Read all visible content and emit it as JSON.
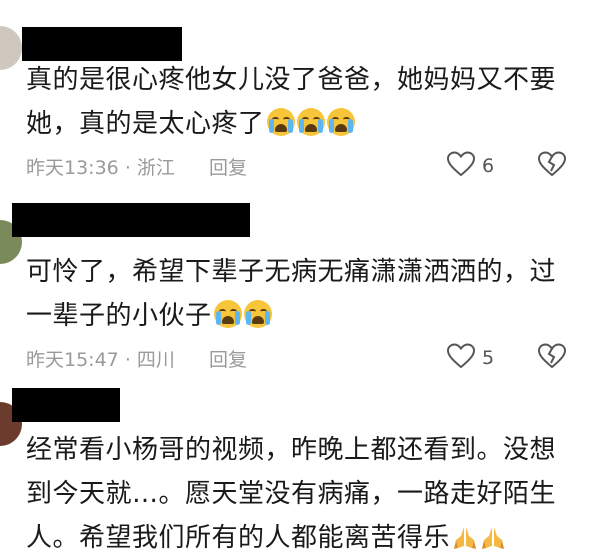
{
  "comments": [
    {
      "lines": [
        "真的是很心疼他女儿没了爸爸，她妈妈又不要",
        "她，真的是太心疼了"
      ],
      "emoji": [
        "crying-face-icon",
        "crying-face-icon",
        "crying-face-icon"
      ],
      "time": "昨天13:36",
      "separator": "·",
      "location": "浙江",
      "reply_label": "回复",
      "likes": "6"
    },
    {
      "lines": [
        "可怜了，希望下辈子无病无痛潇潇洒洒的，过",
        "一辈子的小伙子"
      ],
      "emoji": [
        "crying-face-icon",
        "crying-face-icon"
      ],
      "time": "昨天15:47",
      "separator": "·",
      "location": "四川",
      "reply_label": "回复",
      "likes": "5"
    },
    {
      "lines": [
        "经常看小杨哥的视频，昨晚上都还看到。没想",
        "到今天就…。愿天堂没有病痛，一路走好陌生",
        "人。希望我们所有的人都能离苦得乐"
      ],
      "emoji": [
        "folded-hands-icon",
        "folded-hands-icon"
      ]
    }
  ],
  "colors": {
    "text": "#1a1a1a",
    "meta": "#9a9a9a",
    "redaction": "#000000"
  }
}
